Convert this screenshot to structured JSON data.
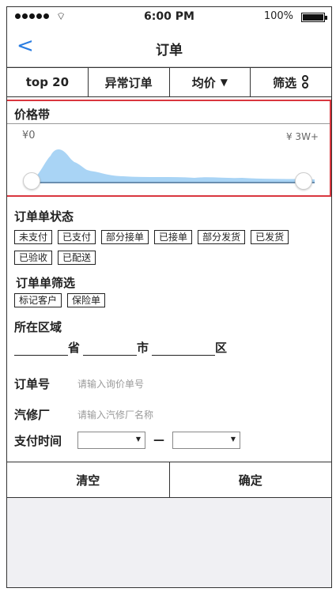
{
  "status_bar": {
    "time": "6:00 PM",
    "battery": "100%"
  },
  "nav": {
    "title": "订单"
  },
  "tabs": [
    {
      "label": "top 20"
    },
    {
      "label": "异常订单"
    },
    {
      "label": "均价"
    },
    {
      "label": "筛选"
    }
  ],
  "price_band": {
    "title": "价格带",
    "min_label": "¥0",
    "max_label": "¥ 3W+"
  },
  "order_status": {
    "title": "订单单状态",
    "chips": [
      "未支付",
      "已支付",
      "部分接单",
      "已接单",
      "部分发货",
      "已发货",
      "已验收",
      "已配送"
    ]
  },
  "order_filter": {
    "title": "订单单筛选",
    "chips": [
      "标记客户",
      "保险单"
    ]
  },
  "region": {
    "title": "所在区域",
    "province": "省",
    "city": "市",
    "district": "区"
  },
  "order_no": {
    "label": "订单号",
    "placeholder": "请输入询价单号"
  },
  "repair_shop": {
    "label": "汽修厂",
    "placeholder": "请输入汽修厂名称"
  },
  "pay_time": {
    "label": "支付时间",
    "separator": "—"
  },
  "footer": {
    "clear_label": "清空",
    "confirm_label": "确定"
  },
  "colors": {
    "accent": "#2a7de1",
    "highlight_border": "#d9363e",
    "chart_fill": "#a9d4f5"
  },
  "icons": {
    "back": "chevron-left-icon",
    "sort": "caret-down-icon",
    "filter": "link-icon"
  }
}
